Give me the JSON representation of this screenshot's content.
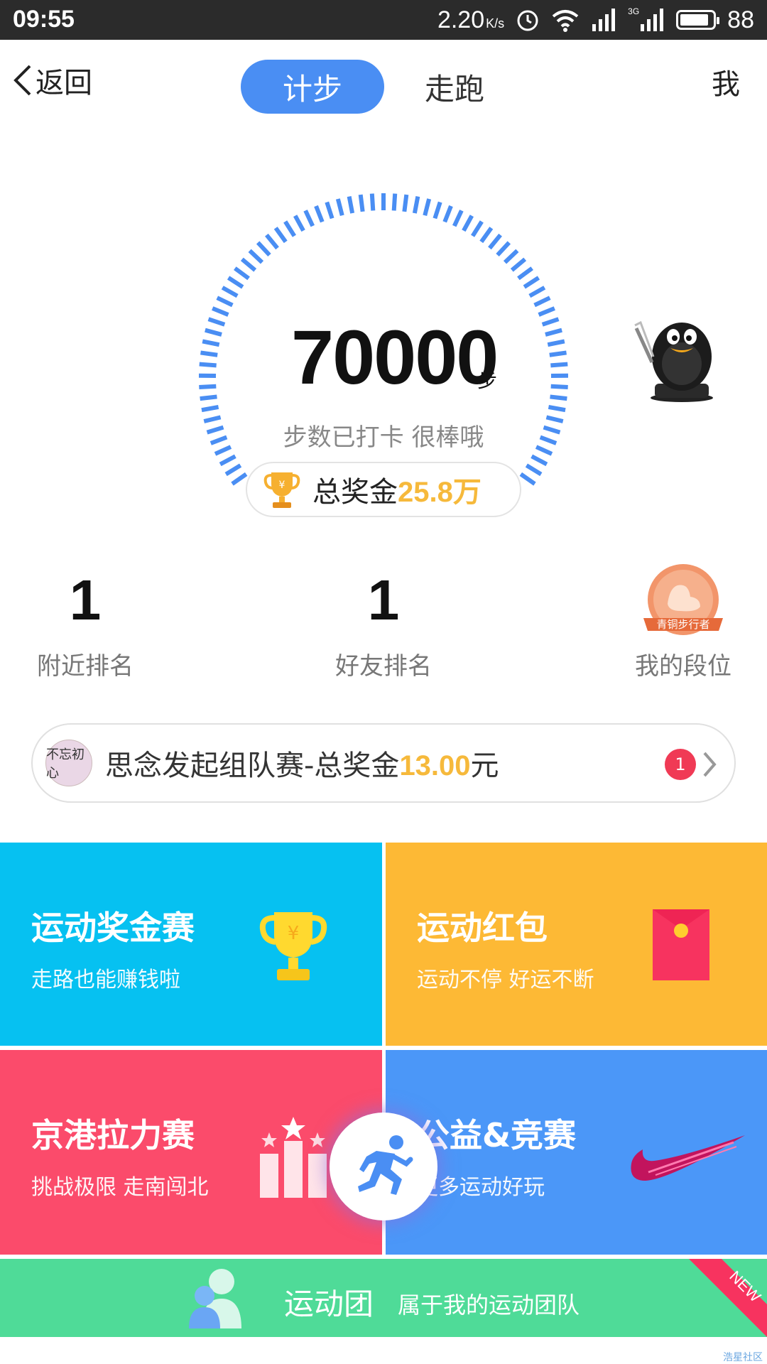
{
  "status_bar": {
    "time": "09:55",
    "speed": "2.20",
    "speed_unit": "K/s",
    "network": "3G",
    "battery": "88"
  },
  "header": {
    "back_label": "返回",
    "tabs": [
      {
        "label": "计步",
        "active": true
      },
      {
        "label": "走跑",
        "active": false
      }
    ],
    "me_label": "我"
  },
  "steps": {
    "value": "70000",
    "unit": "步",
    "caption": "步数已打卡  很棒哦",
    "gauge_color": "#4a8ef3"
  },
  "prize": {
    "label": "总奖金",
    "amount": "25.8万",
    "amount_color": "#f6b93b"
  },
  "rankings": [
    {
      "value": "1",
      "label": "附近排名"
    },
    {
      "value": "1",
      "label": "好友排名"
    }
  ],
  "level": {
    "badge_text": "青铜步行者",
    "label": "我的段位"
  },
  "team_race": {
    "avatar_text": "不忘初心",
    "text_prefix": "思念发起组队赛-总奖金",
    "amount": "13.00",
    "suffix": "元",
    "badge_count": "1"
  },
  "tiles": [
    {
      "title": "运动奖金赛",
      "subtitle": "走路也能赚钱啦",
      "color": "#06c1f1",
      "icon": "trophy-icon"
    },
    {
      "title": "运动红包",
      "subtitle": "运动不停 好运不断",
      "color": "#fdb935",
      "icon": "red-envelope-icon"
    },
    {
      "title": "京港拉力赛",
      "subtitle": "挑战极限 走南闯北",
      "color": "#fb4b6b",
      "icon": "podium-icon"
    },
    {
      "title": "公益&竞赛",
      "subtitle": "更多运动好玩",
      "color": "#4b97f8",
      "icon": "swoosh-icon"
    }
  ],
  "sports_group": {
    "title": "运动团",
    "subtitle": "属于我的运动团队",
    "ribbon": "NEW",
    "color": "#4fdb98"
  },
  "watermark": "浩星社区"
}
